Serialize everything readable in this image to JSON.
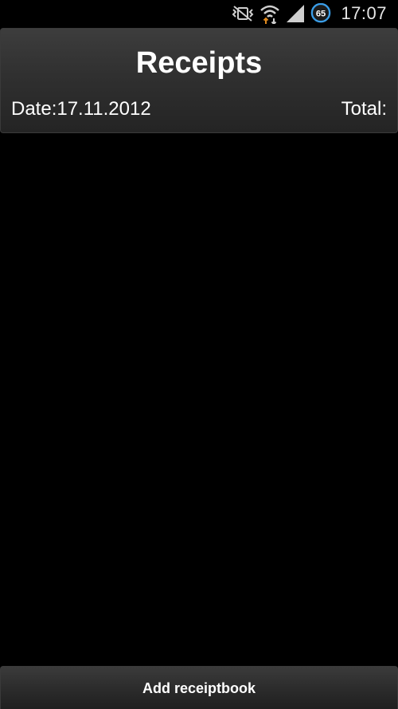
{
  "status_bar": {
    "time": "17:07",
    "battery_level": "65",
    "icons": [
      "vibrate-mute-icon",
      "wifi-icon",
      "signal-icon",
      "battery-icon"
    ]
  },
  "header": {
    "title": "Receipts",
    "date_label": "Date:17.11.2012",
    "total_label": "Total:"
  },
  "receipts": [],
  "actions": {
    "add_receiptbook": "Add receiptbook"
  },
  "colors": {
    "background": "#000000",
    "text": "#ffffff",
    "panel_top": "#3d3d3d",
    "panel_bottom": "#242424",
    "wifi_arrow": "#e08a1e",
    "battery_ring": "#3a9ee8"
  }
}
